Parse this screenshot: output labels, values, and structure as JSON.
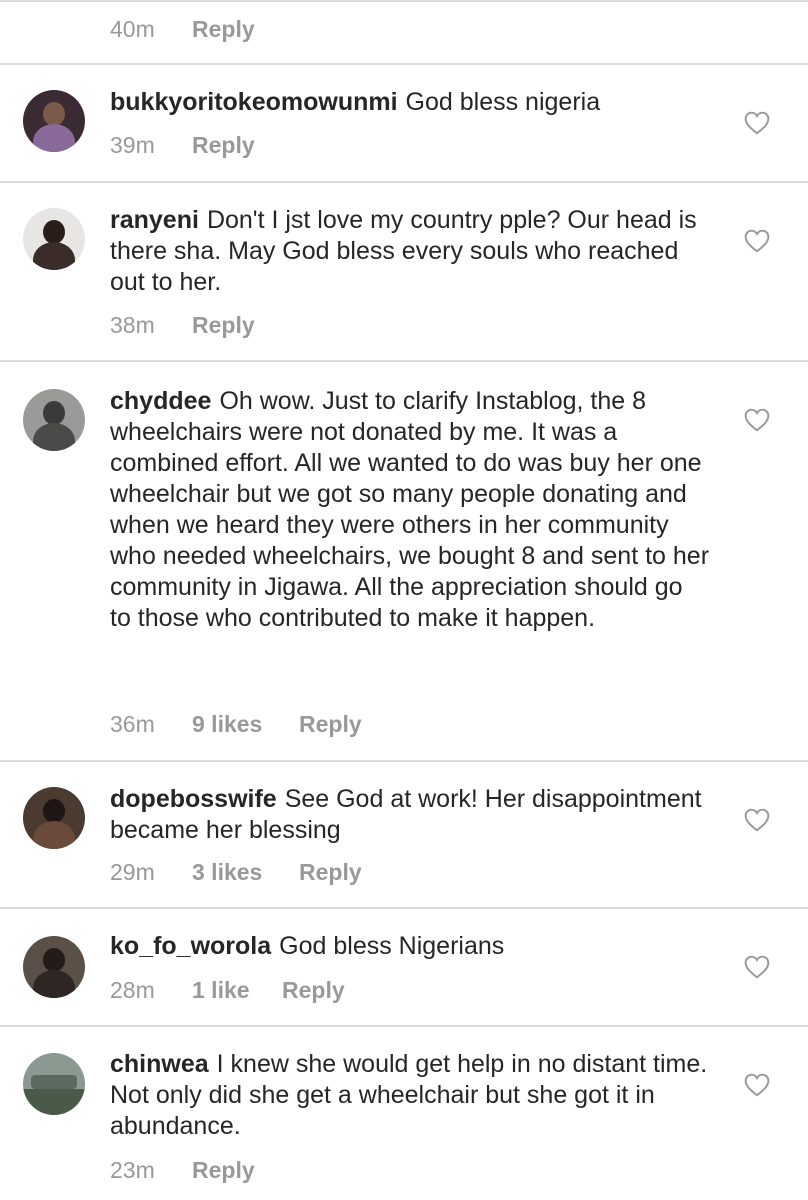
{
  "first_comment_stub": {
    "time": "40m",
    "reply_label": "Reply"
  },
  "comments": [
    {
      "username": "bukkyoritokeomowunmi",
      "text": "God bless nigeria",
      "time": "39m",
      "likes": "",
      "reply_label": "Reply"
    },
    {
      "username": "ranyeni",
      "text": "Don't I jst love my country pple? Our head is there sha. May God bless every souls who reached out to her.",
      "time": "38m",
      "likes": "",
      "reply_label": "Reply"
    },
    {
      "username": "chyddee",
      "text": "Oh wow. Just to clarify Instablog, the 8 wheelchairs were not donated by me. It was a combined effort. All we wanted to do was buy her one wheelchair but we got so many people donating and when we heard they were others in her community who needed wheelchairs, we bought 8 and sent to her community in Jigawa. All the appreciation should go to those who contributed to make it happen.",
      "time": "36m",
      "likes": "9 likes",
      "reply_label": "Reply"
    },
    {
      "username": "dopebosswife",
      "text": "See God at work!  Her disappointment became her blessing",
      "time": "29m",
      "likes": "3 likes",
      "reply_label": "Reply"
    },
    {
      "username": "ko_fo_worola",
      "text": "God bless Nigerians",
      "time": "28m",
      "likes": "1 like",
      "reply_label": "Reply"
    },
    {
      "username": "chinwea",
      "text": "I knew she would get help in no distant time. Not only did she get a wheelchair but she got it in abundance.",
      "time": "23m",
      "likes": "",
      "reply_label": "Reply"
    }
  ],
  "icons": {
    "like": "heart-outline-icon"
  },
  "colors": {
    "text": "#262626",
    "meta": "#999999",
    "divider": "#dbdbdb"
  }
}
